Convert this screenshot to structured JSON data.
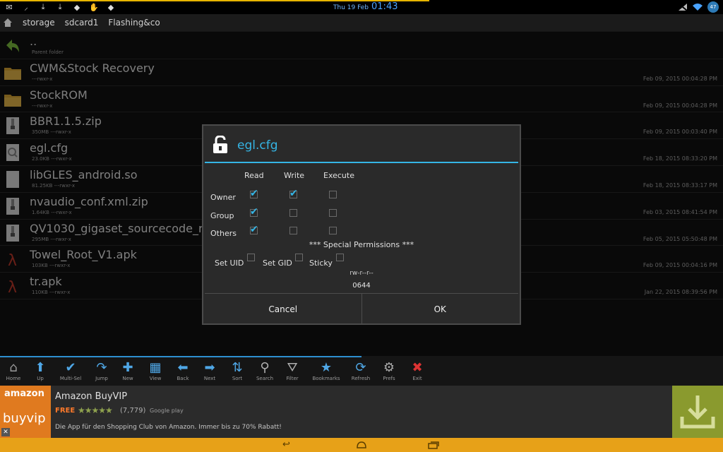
{
  "status": {
    "date": "Thu 19 Feb",
    "time": "01:43",
    "battery": "47",
    "icons": [
      "mail-icon",
      "signal-small-icon",
      "download-icon",
      "download-icon",
      "app-icon",
      "hand-icon",
      "app-icon"
    ]
  },
  "breadcrumb": [
    "storage",
    "sdcard1",
    "Flashing&co"
  ],
  "files": [
    {
      "name": "..",
      "meta": "Parent folder",
      "date": "",
      "icon": "parent"
    },
    {
      "name": "CWM&Stock Recovery",
      "meta": "---rwxr-x",
      "date": "Feb 09, 2015 00:04:28 PM",
      "icon": "folder"
    },
    {
      "name": "StockROM",
      "meta": "---rwxr-x",
      "date": "Feb 09, 2015 00:04:28 PM",
      "icon": "folder"
    },
    {
      "name": "BBR1.1.5.zip",
      "meta": "350MB ---rwxr-x",
      "date": "Feb 09, 2015 00:03:40 PM",
      "icon": "zip"
    },
    {
      "name": "egl.cfg",
      "meta": "23.0KB ---rwxr-x",
      "date": "Feb 18, 2015 08:33:20 PM",
      "icon": "cfg"
    },
    {
      "name": "libGLES_android.so",
      "meta": "81.25KB ---rwxr-x",
      "date": "Feb 18, 2015 08:33:17 PM",
      "icon": "file"
    },
    {
      "name": "nvaudio_conf.xml.zip",
      "meta": "1.64KB ---rwxr-x",
      "date": "Feb 03, 2015 08:41:54 PM",
      "icon": "zip"
    },
    {
      "name": "QV1030_gigaset_sourcecode_release",
      "meta": "295MB ---rwxr-x",
      "date": "Feb 05, 2015 05:50:48 PM",
      "icon": "zip"
    },
    {
      "name": "Towel_Root_V1.apk",
      "meta": "103KB ---rwxr-x",
      "date": "Feb 09, 2015 00:04:16 PM",
      "icon": "apk"
    },
    {
      "name": "tr.apk",
      "meta": "110KB ---rwxr-x",
      "date": "Jan 22, 2015 08:39:56 PM",
      "icon": "apk"
    }
  ],
  "dialog": {
    "title": "egl.cfg",
    "columns": [
      "Read",
      "Write",
      "Execute"
    ],
    "rows": [
      {
        "label": "Owner",
        "checks": [
          true,
          true,
          false
        ]
      },
      {
        "label": "Group",
        "checks": [
          true,
          false,
          false
        ]
      },
      {
        "label": "Others",
        "checks": [
          true,
          false,
          false
        ]
      }
    ],
    "special_title": "*** Special Permissions ***",
    "special": [
      {
        "label": "Set UID",
        "checked": false
      },
      {
        "label": "Set GID",
        "checked": false
      },
      {
        "label": "Sticky",
        "checked": false
      }
    ],
    "perm_string": "rw-r--r--",
    "octal": "0644",
    "cancel": "Cancel",
    "ok": "OK"
  },
  "toolbar": [
    {
      "label": "Home",
      "icon": "home-icon"
    },
    {
      "label": "Up",
      "icon": "arrow-up-icon"
    },
    {
      "label": "Multi-Sel",
      "icon": "checkmark-icon"
    },
    {
      "label": "Jump",
      "icon": "jump-arrow-icon"
    },
    {
      "label": "New",
      "icon": "plus-icon"
    },
    {
      "label": "View",
      "icon": "grid-icon"
    },
    {
      "label": "Back",
      "icon": "arrow-left-icon"
    },
    {
      "label": "Next",
      "icon": "arrow-right-icon"
    },
    {
      "label": "Sort",
      "icon": "sort-icon"
    },
    {
      "label": "Search",
      "icon": "search-icon"
    },
    {
      "label": "Filter",
      "icon": "filter-icon"
    },
    {
      "label": "Bookmarks",
      "icon": "star-icon"
    },
    {
      "label": "Refresh",
      "icon": "refresh-icon"
    },
    {
      "label": "Prefs",
      "icon": "gear-icon"
    },
    {
      "label": "Exit",
      "icon": "close-icon"
    }
  ],
  "ad": {
    "logo_top": "amazon",
    "logo_bottom": "buyvip",
    "title": "Amazon BuyVIP",
    "free": "FREE",
    "stars": "★★★★★",
    "count": "(7,779)",
    "store": "Google play",
    "desc": "Die App für den Shopping Club von Amazon. Immer bis zu 70% Rabatt!"
  },
  "colors": {
    "accent": "#35b5e5",
    "nav": "#e7a118",
    "ad_logo": "#e07a1f"
  }
}
